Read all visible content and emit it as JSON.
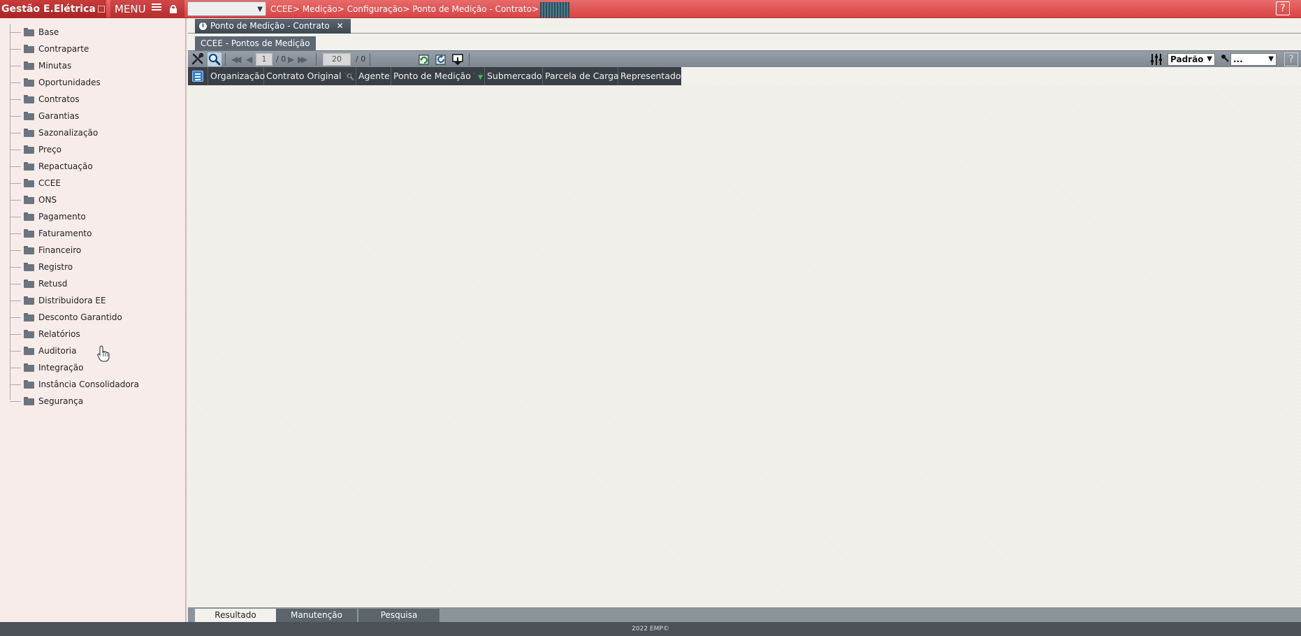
{
  "app": {
    "title": "Gestão E.Elétrica",
    "menu_label": "MENU",
    "breadcrumb": "CCEE> Medição> Configuração> Ponto de Medição - Contrato>",
    "help_label": "?"
  },
  "sidebar": {
    "items": [
      {
        "label": "Base"
      },
      {
        "label": "Contraparte"
      },
      {
        "label": "Minutas"
      },
      {
        "label": "Oportunidades"
      },
      {
        "label": "Contratos"
      },
      {
        "label": "Garantias"
      },
      {
        "label": "Sazonalização"
      },
      {
        "label": "Preço"
      },
      {
        "label": "Repactuação"
      },
      {
        "label": "CCEE"
      },
      {
        "label": "ONS"
      },
      {
        "label": "Pagamento"
      },
      {
        "label": "Faturamento"
      },
      {
        "label": "Financeiro"
      },
      {
        "label": "Registro"
      },
      {
        "label": "Retusd"
      },
      {
        "label": "Distribuidora EE"
      },
      {
        "label": "Desconto Garantido"
      },
      {
        "label": "Relatórios"
      },
      {
        "label": "Auditoria"
      },
      {
        "label": "Integração"
      },
      {
        "label": "Instância Consolidadora"
      },
      {
        "label": "Segurança"
      }
    ]
  },
  "main": {
    "doc_tab_label": "Ponto de Medição - Contrato",
    "doc_tab_close": "✕",
    "subtab_label": "CCEE - Pontos de Medição",
    "toolbar": {
      "page_current": "1",
      "page_total": "/ 0",
      "page_size": "20",
      "page_size_total": "/ 0",
      "view_select": "Padrão",
      "filter_select": "...",
      "help_label": "?"
    },
    "grid": {
      "columns": [
        {
          "label": "Organização"
        },
        {
          "label": "Contrato Original"
        },
        {
          "label": "Agente"
        },
        {
          "label": "Ponto de Medição"
        },
        {
          "label": "Submercado"
        },
        {
          "label": "Parcela de Carga"
        },
        {
          "label": "Representado"
        }
      ]
    },
    "bottom_tabs": {
      "result": "Resultado",
      "maintenance": "Manutenção",
      "search": "Pesquisa"
    }
  },
  "footer": {
    "text": "2022 EMP©"
  },
  "colors": {
    "topbar": "#d94444",
    "sidebar_bg": "#f7ecea",
    "grid_header": "#3a3f45",
    "toolbar": "#8b939b"
  }
}
